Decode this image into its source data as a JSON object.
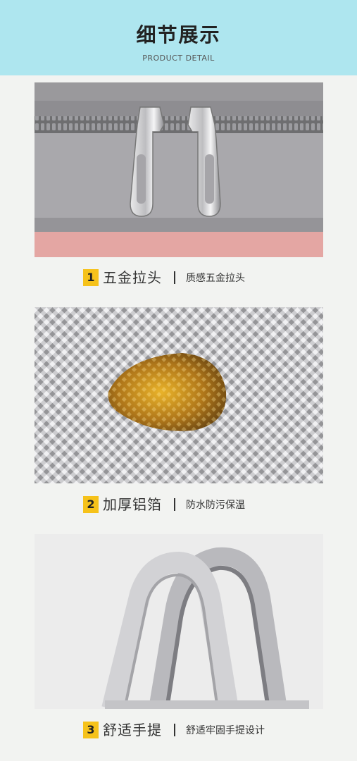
{
  "header": {
    "title": "细节展示",
    "subtitle": "PRODUCT DETAIL"
  },
  "details": [
    {
      "number": "1",
      "title": "五金拉头",
      "description": "质感五金拉头",
      "image": "metal-zipper-pulls-photo"
    },
    {
      "number": "2",
      "title": "加厚铝箔",
      "description": "防水防污保温",
      "image": "aluminum-foil-lining-photo"
    },
    {
      "number": "3",
      "title": "舒适手提",
      "description": "舒适牢固手提设计",
      "image": "tote-handles-photo"
    }
  ],
  "colors": {
    "header_bg": "#aee6ef",
    "page_bg": "#f2f3f1",
    "badge": "#f6c21a",
    "text": "#333333"
  }
}
